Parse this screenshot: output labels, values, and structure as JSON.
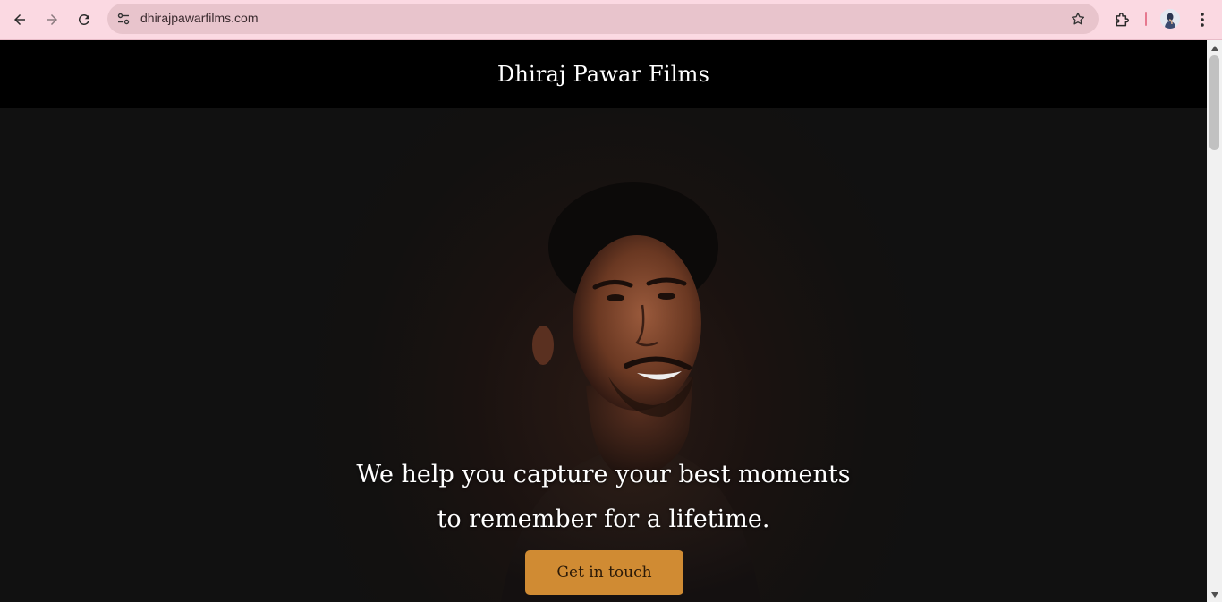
{
  "browser": {
    "url": "dhirajpawarfilms.com",
    "theme_color": "#fbd9e2"
  },
  "site": {
    "title": "Dhiraj Pawar Films"
  },
  "hero": {
    "line1": "We help you capture your best moments",
    "line2": "to remember for a lifetime.",
    "cta_label": "Get in touch",
    "cta_color": "#d08b33"
  },
  "icons": {
    "back": "arrow-left-icon",
    "forward": "arrow-right-icon",
    "reload": "reload-icon",
    "site_info": "tune-icon",
    "bookmark": "star-icon",
    "extensions": "puzzle-icon",
    "menu": "more-vert-icon"
  }
}
